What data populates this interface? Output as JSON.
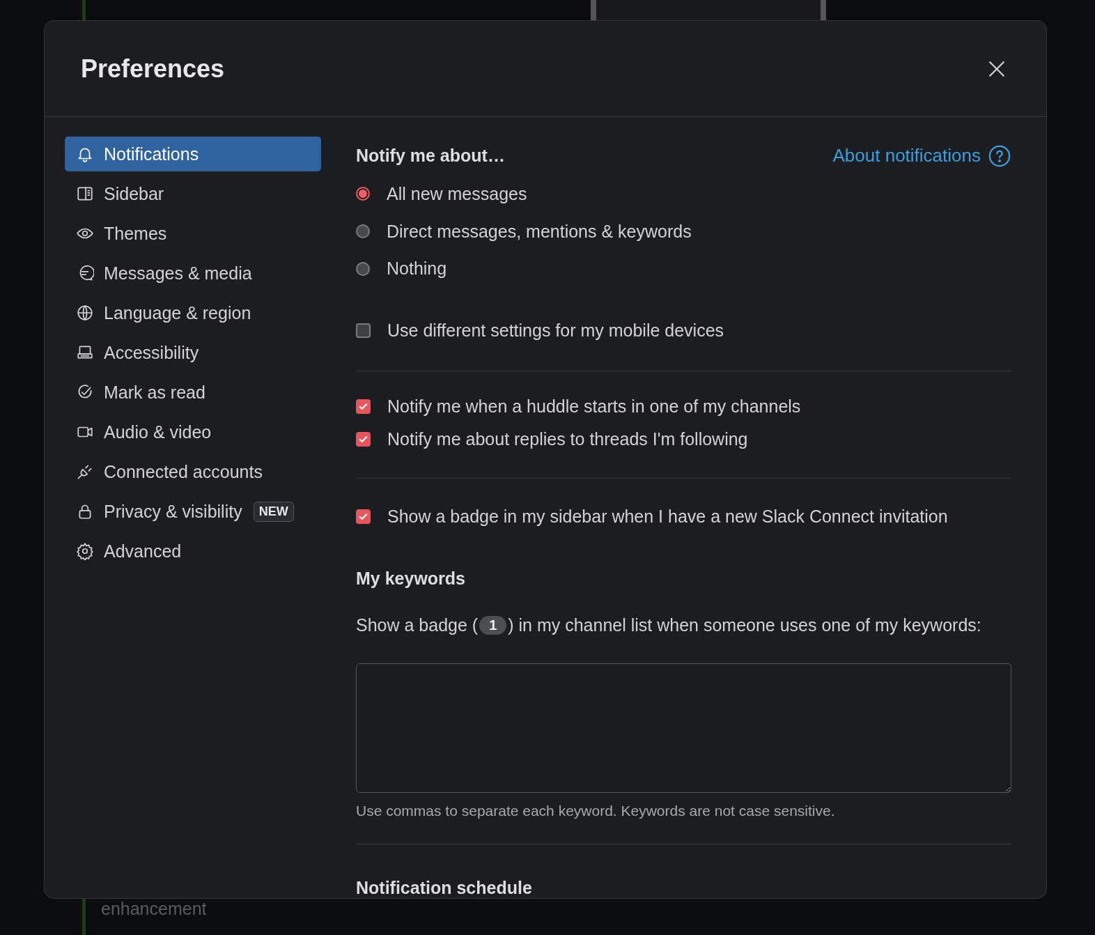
{
  "backdrop": {
    "footer_text": "enhancement"
  },
  "dialog": {
    "title": "Preferences",
    "sidebar": {
      "items": [
        {
          "label": "Notifications",
          "kind": "bell",
          "selected": true
        },
        {
          "label": "Sidebar",
          "kind": "sidebar",
          "selected": false
        },
        {
          "label": "Themes",
          "kind": "eye",
          "selected": false
        },
        {
          "label": "Messages & media",
          "kind": "message",
          "selected": false
        },
        {
          "label": "Language & region",
          "kind": "globe",
          "selected": false
        },
        {
          "label": "Accessibility",
          "kind": "laptop",
          "selected": false
        },
        {
          "label": "Mark as read",
          "kind": "check",
          "selected": false
        },
        {
          "label": "Audio & video",
          "kind": "video",
          "selected": false
        },
        {
          "label": "Connected accounts",
          "kind": "plug",
          "selected": false
        },
        {
          "label": "Privacy & visibility",
          "kind": "lock",
          "selected": false,
          "badge": "NEW"
        },
        {
          "label": "Advanced",
          "kind": "gear",
          "selected": false
        }
      ]
    },
    "content": {
      "heading": "Notify me about…",
      "help_link": "About notifications",
      "radios": [
        {
          "label": "All new messages",
          "selected": true
        },
        {
          "label": "Direct messages, mentions & keywords",
          "selected": false
        },
        {
          "label": "Nothing",
          "selected": false
        }
      ],
      "mobile_checkbox": {
        "label": "Use different settings for my mobile devices",
        "checked": false
      },
      "checkboxes": [
        {
          "label": "Notify me when a huddle starts in one of my channels",
          "checked": true
        },
        {
          "label": "Notify me about replies to threads I'm following",
          "checked": true
        }
      ],
      "badge_checkbox": {
        "label": "Show a badge in my sidebar when I have a new Slack Connect invitation",
        "checked": true
      },
      "keywords": {
        "heading": "My keywords",
        "text_before": "Show a badge (",
        "badge": "1",
        "text_after": ") in my channel list when someone uses one of my keywords:",
        "hint": "Use commas to separate each keyword. Keywords are not case sensitive."
      },
      "schedule_heading": "Notification schedule"
    }
  }
}
